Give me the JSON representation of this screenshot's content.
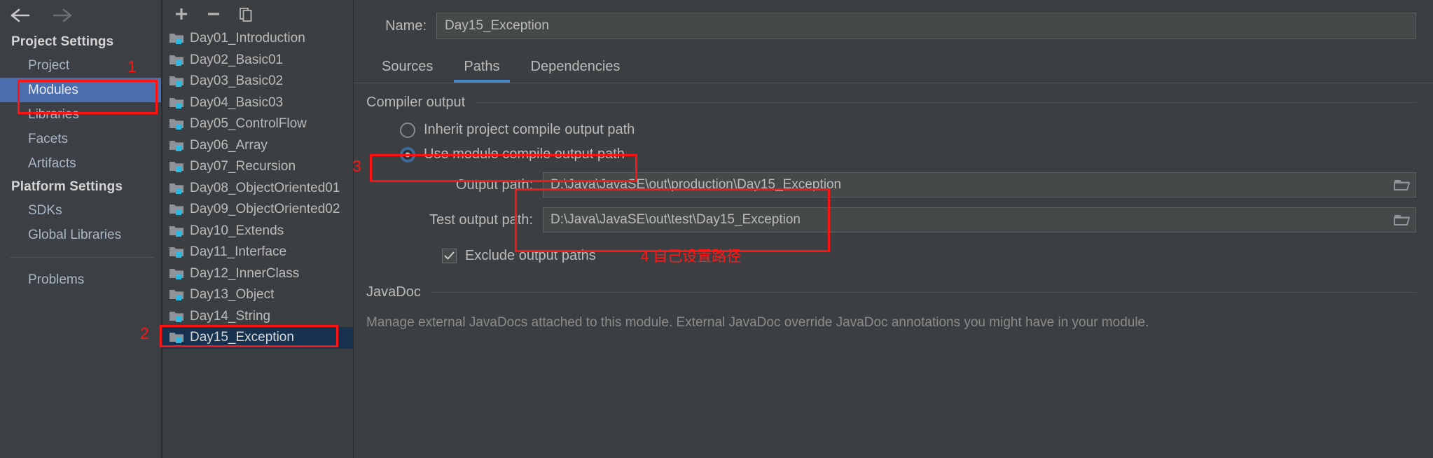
{
  "nav": {
    "back_icon": "arrow-left-icon",
    "forward_icon": "arrow-right-icon",
    "groups": [
      {
        "title": "Project Settings",
        "items": [
          {
            "label": "Project",
            "selected": false
          },
          {
            "label": "Modules",
            "selected": true
          },
          {
            "label": "Libraries",
            "selected": false
          },
          {
            "label": "Facets",
            "selected": false
          },
          {
            "label": "Artifacts",
            "selected": false
          }
        ]
      },
      {
        "title": "Platform Settings",
        "items": [
          {
            "label": "SDKs",
            "selected": false
          },
          {
            "label": "Global Libraries",
            "selected": false
          }
        ]
      }
    ],
    "problems": {
      "label": "Problems"
    }
  },
  "modules": {
    "toolbar": [
      {
        "name": "add-module-button",
        "icon": "plus-icon"
      },
      {
        "name": "remove-module-button",
        "icon": "minus-icon"
      },
      {
        "name": "copy-module-button",
        "icon": "copy-icon"
      }
    ],
    "items": [
      {
        "label": "Day01_Introduction",
        "selected": false
      },
      {
        "label": "Day02_Basic01",
        "selected": false
      },
      {
        "label": "Day03_Basic02",
        "selected": false
      },
      {
        "label": "Day04_Basic03",
        "selected": false
      },
      {
        "label": "Day05_ControlFlow",
        "selected": false
      },
      {
        "label": "Day06_Array",
        "selected": false
      },
      {
        "label": "Day07_Recursion",
        "selected": false
      },
      {
        "label": "Day08_ObjectOriented01",
        "selected": false
      },
      {
        "label": "Day09_ObjectOriented02",
        "selected": false
      },
      {
        "label": "Day10_Extends",
        "selected": false
      },
      {
        "label": "Day11_Interface",
        "selected": false
      },
      {
        "label": "Day12_InnerClass",
        "selected": false
      },
      {
        "label": "Day13_Object",
        "selected": false
      },
      {
        "label": "Day14_String",
        "selected": false
      },
      {
        "label": "Day15_Exception",
        "selected": true
      }
    ]
  },
  "detail": {
    "name_label": "Name:",
    "name_value": "Day15_Exception",
    "tabs": [
      {
        "label": "Sources",
        "active": false
      },
      {
        "label": "Paths",
        "active": true
      },
      {
        "label": "Dependencies",
        "active": false
      }
    ],
    "compiler_output": {
      "section_title": "Compiler output",
      "radio_inherit": {
        "label": "Inherit project compile output path",
        "selected": false
      },
      "radio_module": {
        "label": "Use module compile output path",
        "selected": true
      },
      "output_path": {
        "label": "Output path:",
        "value": "D:\\Java\\JavaSE\\out\\production\\Day15_Exception",
        "browse_icon": "folder-icon"
      },
      "test_output_path": {
        "label": "Test output path:",
        "value": "D:\\Java\\JavaSE\\out\\test\\Day15_Exception",
        "browse_icon": "folder-icon"
      },
      "exclude_checkbox": {
        "label": "Exclude output paths",
        "checked": true,
        "icon": "checkmark-icon"
      }
    },
    "javadoc": {
      "section_title": "JavaDoc",
      "description": "Manage external JavaDocs attached to this module. External JavaDoc override JavaDoc annotations you might have in your module."
    }
  },
  "annotations": {
    "color": "#ff1414",
    "markers": [
      {
        "number": "1",
        "target": "modules-nav-item"
      },
      {
        "number": "2",
        "target": "day15-module-row"
      },
      {
        "number": "3",
        "target": "use-module-output-radio"
      },
      {
        "number": "4",
        "target": "output-path-fields",
        "text": "4 自己设置路径"
      }
    ]
  }
}
